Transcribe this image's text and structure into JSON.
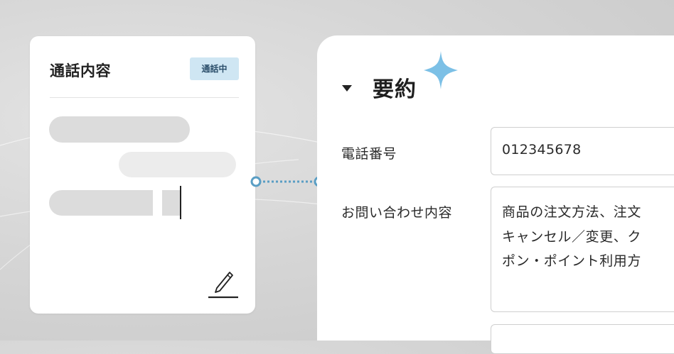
{
  "call_card": {
    "title": "通話内容",
    "badge": "通話中"
  },
  "summary": {
    "title": "要約",
    "fields": [
      {
        "label": "電話番号",
        "value": "012345678"
      },
      {
        "label": "お問い合わせ内容",
        "value_lines": [
          "商品の注文方法、注文",
          "キャンセル／変更、ク",
          "ポン・ポイント利用方"
        ]
      }
    ]
  },
  "colors": {
    "badge_bg": "#cfe6f3",
    "badge_text": "#2c4f6b",
    "connector": "#5a9ec4",
    "sparkle": "#7cc0e6"
  },
  "icons": [
    "pencil-icon",
    "caret-down-icon",
    "sparkle-icon"
  ]
}
